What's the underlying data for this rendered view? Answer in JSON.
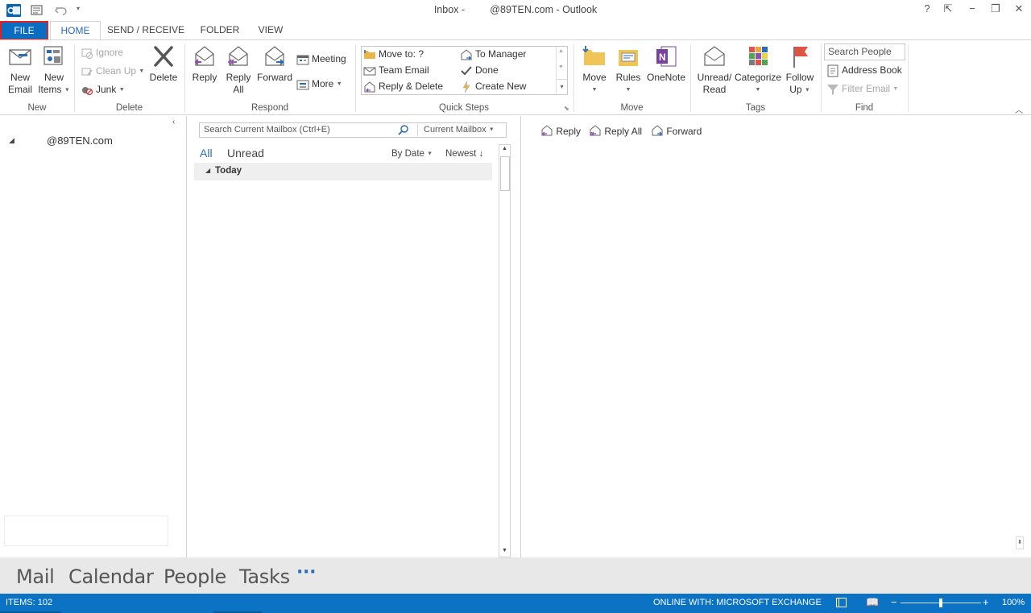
{
  "titlebar": {
    "title": "Inbox -         @89TEN.com - Outlook",
    "help": "?",
    "restore_ribbon": "⇱",
    "minimize": "−",
    "maximize": "❐",
    "close": "✕"
  },
  "tabs": [
    "FILE",
    "HOME",
    "SEND / RECEIVE",
    "FOLDER",
    "VIEW"
  ],
  "ribbon": {
    "new": {
      "new_email": [
        "New",
        "Email"
      ],
      "new_items": [
        "New",
        "Items"
      ],
      "label": "New"
    },
    "delete": {
      "ignore": "Ignore",
      "clean_up": "Clean Up",
      "junk": "Junk",
      "delete": "Delete",
      "label": "Delete"
    },
    "respond": {
      "reply": "Reply",
      "reply_all": [
        "Reply",
        "All"
      ],
      "forward": "Forward",
      "meeting": "Meeting",
      "more": "More",
      "label": "Respond"
    },
    "quick_steps": {
      "move_to": "Move to: ?",
      "team_email": "Team Email",
      "reply_delete": "Reply & Delete",
      "to_manager": "To Manager",
      "done": "Done",
      "create_new": "Create New",
      "label": "Quick Steps"
    },
    "move": {
      "move": "Move",
      "rules": "Rules",
      "onenote": "OneNote",
      "label": "Move"
    },
    "tags": {
      "unread_read": [
        "Unread/",
        "Read"
      ],
      "categorize": "Categorize",
      "follow_up": [
        "Follow",
        "Up"
      ],
      "label": "Tags"
    },
    "find": {
      "search_people": "Search People",
      "address_book": "Address Book",
      "filter_email": "Filter Email",
      "label": "Find"
    }
  },
  "folder_pane": {
    "account": "@89TEN.com"
  },
  "message_list": {
    "search_placeholder": "Search Current Mailbox (Ctrl+E)",
    "scope": "Current Mailbox",
    "filter_all": "All",
    "filter_unread": "Unread",
    "sort_by": "By Date",
    "sort_order": "Newest",
    "group_today": "Today"
  },
  "reading_pane": {
    "reply": "Reply",
    "reply_all": "Reply All",
    "forward": "Forward"
  },
  "navbar": {
    "mail": "Mail",
    "calendar": "Calendar",
    "people": "People",
    "tasks": "Tasks",
    "more": "···"
  },
  "statusbar": {
    "items": "ITEMS: 102",
    "connection": "ONLINE WITH: MICROSOFT EXCHANGE",
    "zoom": "100%",
    "zoom_level": 1.0
  },
  "colors": {
    "accent": "#0b72c4",
    "file_tab": "#0a6dc2",
    "highlight": "#e02222"
  }
}
